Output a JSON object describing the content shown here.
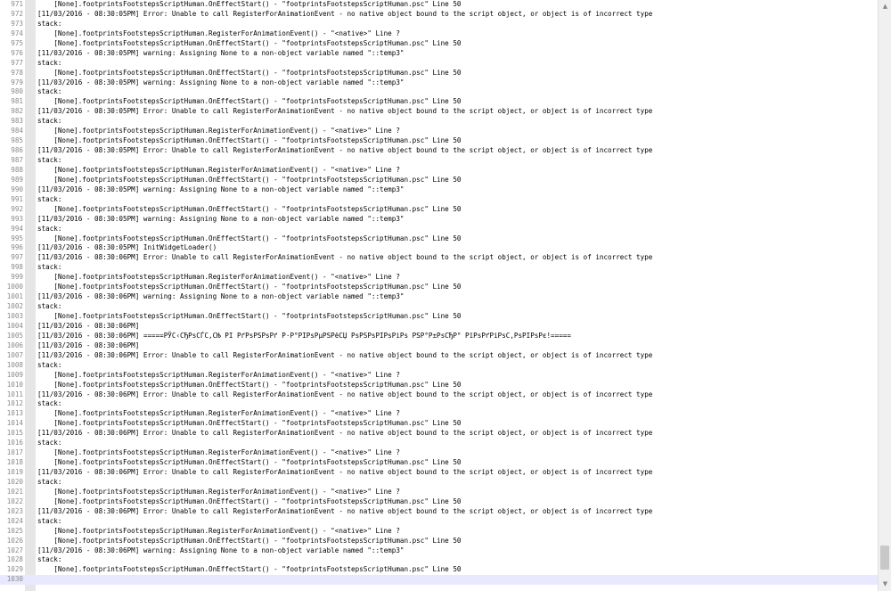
{
  "editor": {
    "current_line": "1030",
    "lines": [
      {
        "n": "971",
        "t": "    [None].footprintsFootstepsScriptHuman.OnEffectStart() - \"footprintsFootstepsScriptHuman.psc\" Line 50"
      },
      {
        "n": "972",
        "t": "[11/03/2016 - 08:30:05PM] Error: Unable to call RegisterForAnimationEvent - no native object bound to the script object, or object is of incorrect type"
      },
      {
        "n": "973",
        "t": "stack:"
      },
      {
        "n": "974",
        "t": "    [None].footprintsFootstepsScriptHuman.RegisterForAnimationEvent() - \"<native>\" Line ?"
      },
      {
        "n": "975",
        "t": "    [None].footprintsFootstepsScriptHuman.OnEffectStart() - \"footprintsFootstepsScriptHuman.psc\" Line 50"
      },
      {
        "n": "976",
        "t": "[11/03/2016 - 08:30:05PM] warning: Assigning None to a non-object variable named \"::temp3\""
      },
      {
        "n": "977",
        "t": "stack:"
      },
      {
        "n": "978",
        "t": "    [None].footprintsFootstepsScriptHuman.OnEffectStart() - \"footprintsFootstepsScriptHuman.psc\" Line 50"
      },
      {
        "n": "979",
        "t": "[11/03/2016 - 08:30:05PM] warning: Assigning None to a non-object variable named \"::temp3\""
      },
      {
        "n": "980",
        "t": "stack:"
      },
      {
        "n": "981",
        "t": "    [None].footprintsFootstepsScriptHuman.OnEffectStart() - \"footprintsFootstepsScriptHuman.psc\" Line 50"
      },
      {
        "n": "982",
        "t": "[11/03/2016 - 08:30:05PM] Error: Unable to call RegisterForAnimationEvent - no native object bound to the script object, or object is of incorrect type"
      },
      {
        "n": "983",
        "t": "stack:"
      },
      {
        "n": "984",
        "t": "    [None].footprintsFootstepsScriptHuman.RegisterForAnimationEvent() - \"<native>\" Line ?"
      },
      {
        "n": "985",
        "t": "    [None].footprintsFootstepsScriptHuman.OnEffectStart() - \"footprintsFootstepsScriptHuman.psc\" Line 50"
      },
      {
        "n": "986",
        "t": "[11/03/2016 - 08:30:05PM] Error: Unable to call RegisterForAnimationEvent - no native object bound to the script object, or object is of incorrect type"
      },
      {
        "n": "987",
        "t": "stack:"
      },
      {
        "n": "988",
        "t": "    [None].footprintsFootstepsScriptHuman.RegisterForAnimationEvent() - \"<native>\" Line ?"
      },
      {
        "n": "989",
        "t": "    [None].footprintsFootstepsScriptHuman.OnEffectStart() - \"footprintsFootstepsScriptHuman.psc\" Line 50"
      },
      {
        "n": "990",
        "t": "[11/03/2016 - 08:30:05PM] warning: Assigning None to a non-object variable named \"::temp3\""
      },
      {
        "n": "991",
        "t": "stack:"
      },
      {
        "n": "992",
        "t": "    [None].footprintsFootstepsScriptHuman.OnEffectStart() - \"footprintsFootstepsScriptHuman.psc\" Line 50"
      },
      {
        "n": "993",
        "t": "[11/03/2016 - 08:30:05PM] warning: Assigning None to a non-object variable named \"::temp3\""
      },
      {
        "n": "994",
        "t": "stack:"
      },
      {
        "n": "995",
        "t": "    [None].footprintsFootstepsScriptHuman.OnEffectStart() - \"footprintsFootstepsScriptHuman.psc\" Line 50"
      },
      {
        "n": "996",
        "t": "[11/03/2016 - 08:30:05PM] InitWidgetLoader()"
      },
      {
        "n": "997",
        "t": "[11/03/2016 - 08:30:06PM] Error: Unable to call RegisterForAnimationEvent - no native object bound to the script object, or object is of incorrect type"
      },
      {
        "n": "998",
        "t": "stack:"
      },
      {
        "n": "999",
        "t": "    [None].footprintsFootstepsScriptHuman.RegisterForAnimationEvent() - \"<native>\" Line ?"
      },
      {
        "n": "1000",
        "t": "    [None].footprintsFootstepsScriptHuman.OnEffectStart() - \"footprintsFootstepsScriptHuman.psc\" Line 50"
      },
      {
        "n": "1001",
        "t": "[11/03/2016 - 08:30:06PM] warning: Assigning None to a non-object variable named \"::temp3\""
      },
      {
        "n": "1002",
        "t": "stack:"
      },
      {
        "n": "1003",
        "t": "    [None].footprintsFootstepsScriptHuman.OnEffectStart() - \"footprintsFootstepsScriptHuman.psc\" Line 50"
      },
      {
        "n": "1004",
        "t": "[11/03/2016 - 08:30:06PM]"
      },
      {
        "n": "1005",
        "t": "[11/03/2016 - 08:30:06PM] =====РЎС‹СЂРѕСЃС‚СЊ РІ РґРѕРЅРѕРґ Р·Р°РІРѕРµРЅРёСЏ РѕРЅРѕРІРѕРіРѕ РЅР°Р±РѕСЂР° РїРѕРґРіРѕС‚РѕРІРѕРє!====="
      },
      {
        "n": "1006",
        "t": "[11/03/2016 - 08:30:06PM]"
      },
      {
        "n": "1007",
        "t": "[11/03/2016 - 08:30:06PM] Error: Unable to call RegisterForAnimationEvent - no native object bound to the script object, or object is of incorrect type"
      },
      {
        "n": "1008",
        "t": "stack:"
      },
      {
        "n": "1009",
        "t": "    [None].footprintsFootstepsScriptHuman.RegisterForAnimationEvent() - \"<native>\" Line ?"
      },
      {
        "n": "1010",
        "t": "    [None].footprintsFootstepsScriptHuman.OnEffectStart() - \"footprintsFootstepsScriptHuman.psc\" Line 50"
      },
      {
        "n": "1011",
        "t": "[11/03/2016 - 08:30:06PM] Error: Unable to call RegisterForAnimationEvent - no native object bound to the script object, or object is of incorrect type"
      },
      {
        "n": "1012",
        "t": "stack:"
      },
      {
        "n": "1013",
        "t": "    [None].footprintsFootstepsScriptHuman.RegisterForAnimationEvent() - \"<native>\" Line ?"
      },
      {
        "n": "1014",
        "t": "    [None].footprintsFootstepsScriptHuman.OnEffectStart() - \"footprintsFootstepsScriptHuman.psc\" Line 50"
      },
      {
        "n": "1015",
        "t": "[11/03/2016 - 08:30:06PM] Error: Unable to call RegisterForAnimationEvent - no native object bound to the script object, or object is of incorrect type"
      },
      {
        "n": "1016",
        "t": "stack:"
      },
      {
        "n": "1017",
        "t": "    [None].footprintsFootstepsScriptHuman.RegisterForAnimationEvent() - \"<native>\" Line ?"
      },
      {
        "n": "1018",
        "t": "    [None].footprintsFootstepsScriptHuman.OnEffectStart() - \"footprintsFootstepsScriptHuman.psc\" Line 50"
      },
      {
        "n": "1019",
        "t": "[11/03/2016 - 08:30:06PM] Error: Unable to call RegisterForAnimationEvent - no native object bound to the script object, or object is of incorrect type"
      },
      {
        "n": "1020",
        "t": "stack:"
      },
      {
        "n": "1021",
        "t": "    [None].footprintsFootstepsScriptHuman.RegisterForAnimationEvent() - \"<native>\" Line ?"
      },
      {
        "n": "1022",
        "t": "    [None].footprintsFootstepsScriptHuman.OnEffectStart() - \"footprintsFootstepsScriptHuman.psc\" Line 50"
      },
      {
        "n": "1023",
        "t": "[11/03/2016 - 08:30:06PM] Error: Unable to call RegisterForAnimationEvent - no native object bound to the script object, or object is of incorrect type"
      },
      {
        "n": "1024",
        "t": "stack:"
      },
      {
        "n": "1025",
        "t": "    [None].footprintsFootstepsScriptHuman.RegisterForAnimationEvent() - \"<native>\" Line ?"
      },
      {
        "n": "1026",
        "t": "    [None].footprintsFootstepsScriptHuman.OnEffectStart() - \"footprintsFootstepsScriptHuman.psc\" Line 50"
      },
      {
        "n": "1027",
        "t": "[11/03/2016 - 08:30:06PM] warning: Assigning None to a non-object variable named \"::temp3\""
      },
      {
        "n": "1028",
        "t": "stack:"
      },
      {
        "n": "1029",
        "t": "    [None].footprintsFootstepsScriptHuman.OnEffectStart() - \"footprintsFootstepsScriptHuman.psc\" Line 50"
      },
      {
        "n": "1030",
        "t": ""
      }
    ]
  },
  "scrollbar": {
    "up_arrow": "▲",
    "down_arrow": "▼"
  }
}
